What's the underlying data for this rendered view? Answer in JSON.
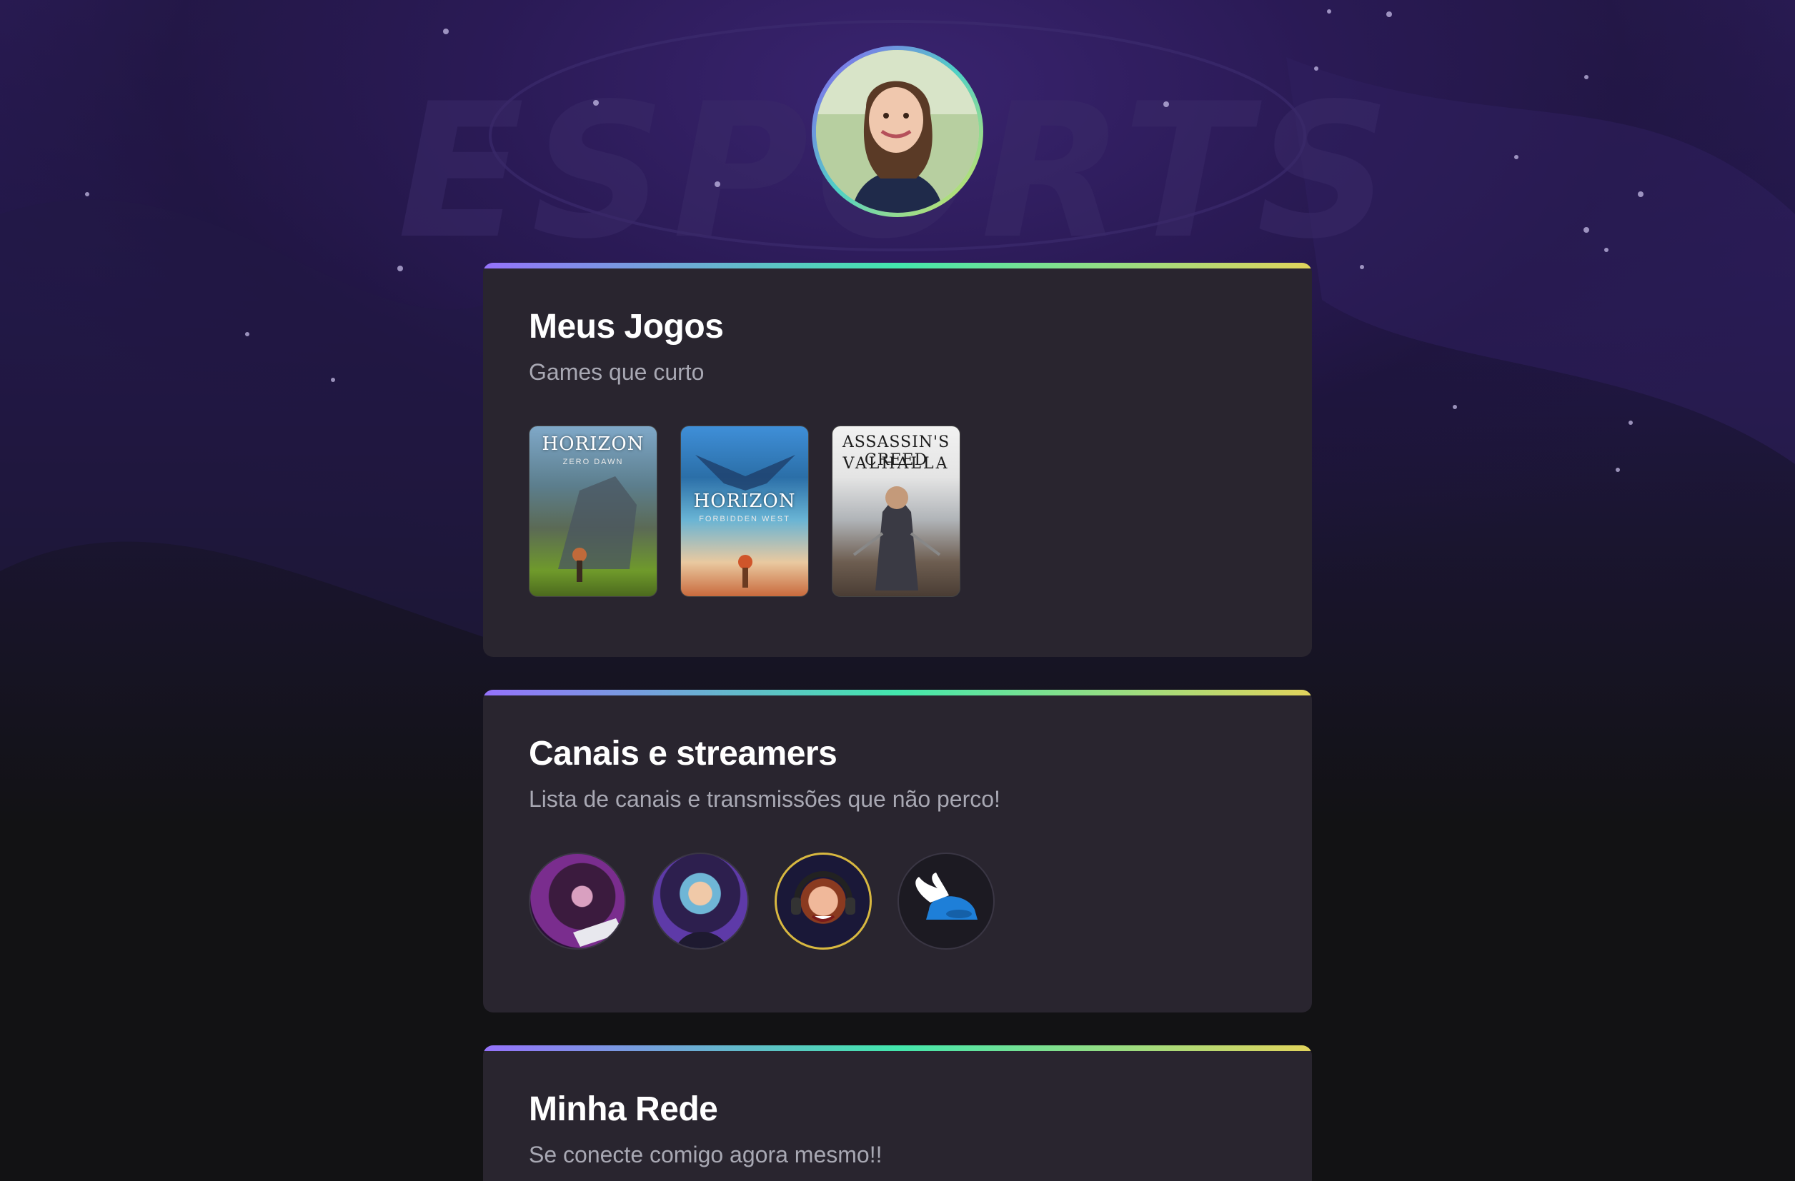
{
  "background": {
    "watermark_text": "ESPORTS"
  },
  "profile": {
    "avatar_alt": "profile-photo"
  },
  "sections": {
    "games": {
      "title": "Meus Jogos",
      "subtitle": "Games que curto",
      "items": [
        {
          "name": "Horizon Zero Dawn",
          "logo": "HORIZON",
          "tagline": "ZERO DAWN"
        },
        {
          "name": "Horizon Forbidden West",
          "logo": "HORIZON",
          "tagline": "FORBIDDEN WEST"
        },
        {
          "name": "Assassin's Creed Valhalla",
          "logo": "ASSASSIN'S CREED",
          "tagline": "VALHALLA"
        }
      ]
    },
    "streamers": {
      "title": "Canais e streamers",
      "subtitle": "Lista de canais e transmissões que não perco!"
    },
    "network": {
      "title": "Minha Rede",
      "subtitle": "Se conecte comigo agora mesmo!!"
    }
  },
  "colors": {
    "accent_gradient": [
      "#9572fc",
      "#43e7ad",
      "#e2d45c"
    ],
    "card_bg": "#29252f",
    "page_bg": "#121214"
  }
}
